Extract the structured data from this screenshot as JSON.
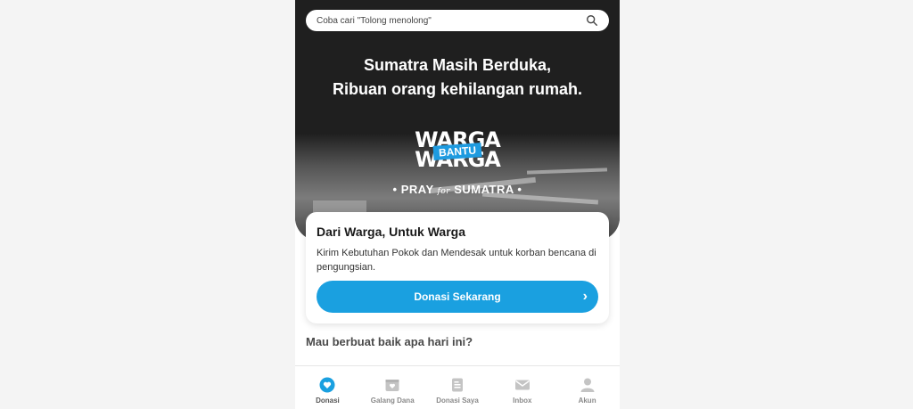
{
  "search": {
    "placeholder": "Coba cari \"Tolong menolong\""
  },
  "hero": {
    "headline_line1": "Sumatra Masih Berduka,",
    "headline_line2": "Ribuan orang kehilangan rumah.",
    "logo_top": "WARGA",
    "logo_badge": "BANTU",
    "logo_bottom": "WARGA",
    "pray_prefix": "• PRAY",
    "pray_for": "for",
    "pray_suffix": "SUMATRA •"
  },
  "card": {
    "title": "Dari Warga, Untuk Warga",
    "description": "Kirim Kebutuhan Pokok dan Mendesak untuk korban bencana di pengungsian.",
    "cta_label": "Donasi Sekarang"
  },
  "section": {
    "title": "Mau berbuat baik apa hari ini?"
  },
  "nav": {
    "items": [
      {
        "label": "Donasi",
        "icon": "heart-icon"
      },
      {
        "label": "Galang Dana",
        "icon": "fundraise-icon"
      },
      {
        "label": "Donasi Saya",
        "icon": "document-icon"
      },
      {
        "label": "Inbox",
        "icon": "mail-icon"
      },
      {
        "label": "Akun",
        "icon": "user-icon"
      }
    ],
    "active_color": "#1aa0e0",
    "inactive_color": "#c4c4c4"
  },
  "colors": {
    "brand": "#1aa0e0",
    "hero_bg": "#1f1f1f"
  }
}
